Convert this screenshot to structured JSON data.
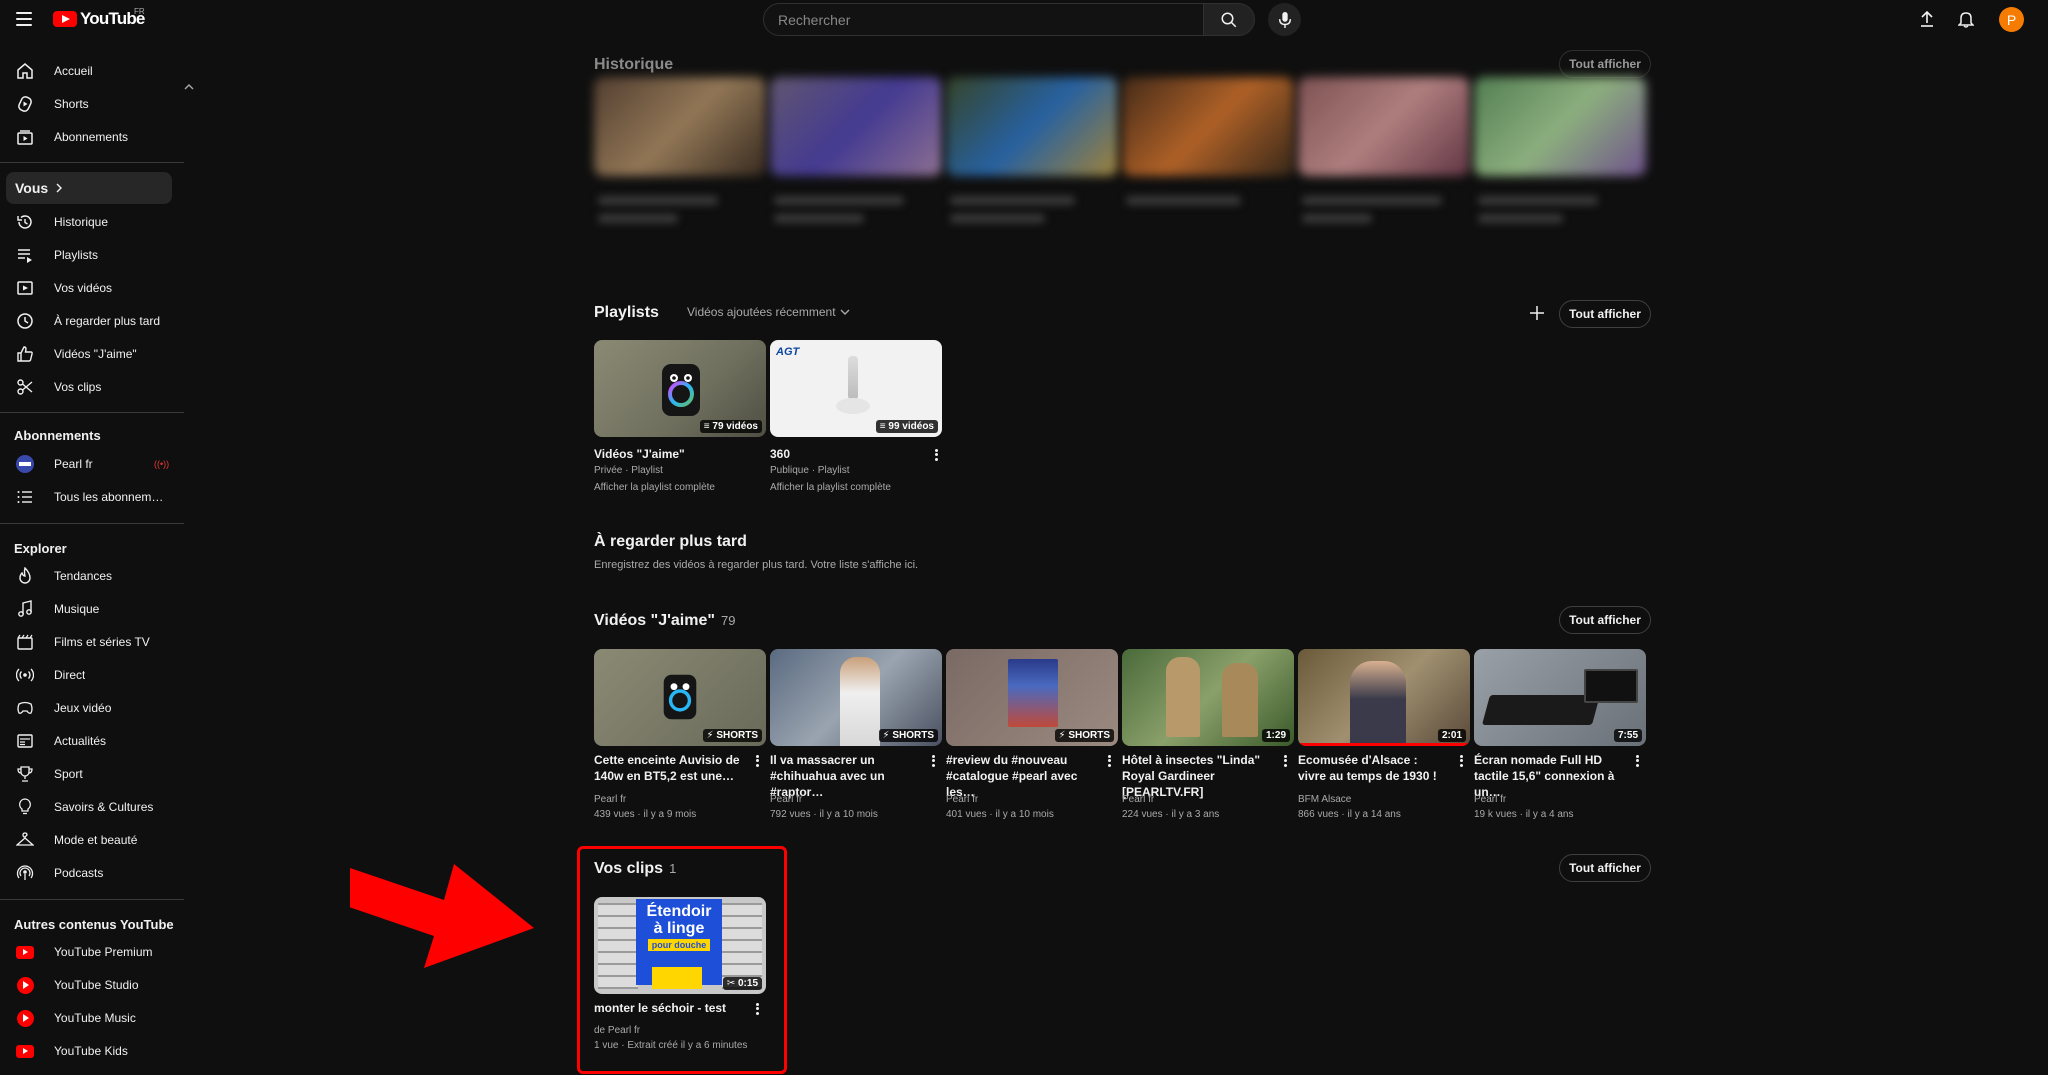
{
  "header": {
    "logo_text": "YouTube",
    "country": "FR",
    "search_placeholder": "Rechercher",
    "avatar_letter": "P"
  },
  "sidebar": {
    "main": [
      {
        "label": "Accueil",
        "icon": "home-icon"
      },
      {
        "label": "Shorts",
        "icon": "shorts-icon"
      },
      {
        "label": "Abonnements",
        "icon": "subscriptions-icon"
      }
    ],
    "vous_label": "Vous",
    "vous": [
      {
        "label": "Historique",
        "icon": "history-icon"
      },
      {
        "label": "Playlists",
        "icon": "playlists-icon"
      },
      {
        "label": "Vos vidéos",
        "icon": "your-videos-icon"
      },
      {
        "label": "À regarder plus tard",
        "icon": "watch-later-icon"
      },
      {
        "label": "Vidéos \"J'aime\"",
        "icon": "like-icon"
      },
      {
        "label": "Vos clips",
        "icon": "scissors-icon"
      }
    ],
    "subs_heading": "Abonnements",
    "subs": [
      {
        "label": "Pearl fr",
        "icon": "channel-avatar"
      },
      {
        "label": "Tous les abonnements",
        "icon": "list-icon"
      }
    ],
    "explore_heading": "Explorer",
    "explore": [
      {
        "label": "Tendances",
        "icon": "trending-icon"
      },
      {
        "label": "Musique",
        "icon": "music-icon"
      },
      {
        "label": "Films et séries TV",
        "icon": "film-icon"
      },
      {
        "label": "Direct",
        "icon": "live-icon"
      },
      {
        "label": "Jeux vidéo",
        "icon": "gaming-icon"
      },
      {
        "label": "Actualités",
        "icon": "news-icon"
      },
      {
        "label": "Sport",
        "icon": "trophy-icon"
      },
      {
        "label": "Savoirs & Cultures",
        "icon": "bulb-icon"
      },
      {
        "label": "Mode et beauté",
        "icon": "hanger-icon"
      },
      {
        "label": "Podcasts",
        "icon": "podcast-icon"
      }
    ],
    "other_heading": "Autres contenus YouTube",
    "other": [
      {
        "label": "YouTube Premium",
        "icon": "yt-premium-icon"
      },
      {
        "label": "YouTube Studio",
        "icon": "yt-studio-icon"
      },
      {
        "label": "YouTube Music",
        "icon": "yt-music-icon"
      },
      {
        "label": "YouTube Kids",
        "icon": "yt-kids-icon"
      }
    ]
  },
  "main": {
    "history": {
      "title": "Historique",
      "button": "Tout afficher"
    },
    "playlists": {
      "title": "Playlists",
      "sort": "Vidéos ajoutées récemment",
      "button": "Tout afficher",
      "items": [
        {
          "title": "Vidéos \"J'aime\"",
          "meta": "Privée · Playlist",
          "link": "Afficher la playlist complète",
          "badge": "79 vidéos"
        },
        {
          "title": "360",
          "meta": "Publique · Playlist",
          "link": "Afficher la playlist complète",
          "badge": "99 vidéos",
          "logo": "AGT"
        }
      ]
    },
    "watch_later": {
      "title": "À regarder plus tard",
      "desc": "Enregistrez des vidéos à regarder plus tard. Votre liste s'affiche ici."
    },
    "liked": {
      "title": "Vidéos \"J'aime\"",
      "count": "79",
      "button": "Tout afficher",
      "items": [
        {
          "title": "Cette enceinte Auvisio de 140w en BT5,2 est une…",
          "channel": "Pearl fr",
          "meta": "439 vues · il y a 9 mois",
          "badge": "SHORTS"
        },
        {
          "title": "Il va massacrer un #chihuahua avec un #raptor…",
          "channel": "Pearl fr",
          "meta": "792 vues · il y a 10 mois",
          "badge": "SHORTS"
        },
        {
          "title": "#review du #nouveau #catalogue #pearl avec les…",
          "channel": "Pearl fr",
          "meta": "401 vues · il y a 10 mois",
          "badge": "SHORTS"
        },
        {
          "title": "Hôtel à insectes \"Linda\" Royal Gardineer [PEARLTV.FR]",
          "channel": "Pearl fr",
          "meta": "224 vues · il y a 3 ans",
          "badge": "1:29"
        },
        {
          "title": "Ecomusée d'Alsace : vivre au temps de 1930 !",
          "channel": "BFM Alsace",
          "meta": "866 vues · il y a 14 ans",
          "badge": "2:01",
          "progress": 1.0
        },
        {
          "title": "Écran nomade Full HD tactile 15,6\" connexion à un…",
          "channel": "Pearl fr",
          "meta": "19 k vues · il y a 4 ans",
          "badge": "7:55"
        }
      ]
    },
    "clips": {
      "title": "Vos clips",
      "count": "1",
      "button": "Tout afficher",
      "item": {
        "title": "monter le séchoir - test",
        "channel": "de Pearl fr",
        "meta": "1 vue · Extrait créé il y a 6 minutes",
        "badge": "0:15",
        "thumb_line1": "Étendoir",
        "thumb_line2": "à linge",
        "thumb_line3": "pour douche"
      }
    }
  },
  "colors": {
    "accent": "#ff0000",
    "background": "#0f0f0f",
    "avatar": "#f57c00"
  }
}
